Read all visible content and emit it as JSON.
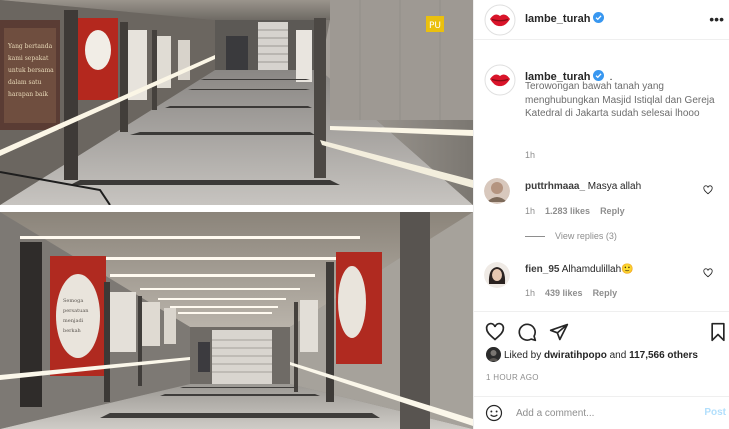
{
  "post": {
    "author": "lambe_turah",
    "verified": true,
    "caption_author": "lambe_turah",
    "caption_dot": ".",
    "caption": "Terowongan bawah tanah yang menghubungkan Masjid Istiqlal dan Gereja Katedral di Jakarta sudah selesai lhooo",
    "caption_time": "1h",
    "image_alt": "Terowongan bawah tanah (tunnel interior photos)"
  },
  "comments": [
    {
      "username": "puttrhmaaa_",
      "text": "Masya allah",
      "time": "1h",
      "likes": "1.283 likes",
      "reply": "Reply",
      "view_replies": "View replies (3)"
    },
    {
      "username": "fien_95",
      "text": "Alhamdulillah🙂",
      "time": "1h",
      "likes": "439 likes",
      "reply": "Reply"
    }
  ],
  "engagement": {
    "liked_prefix": "Liked by ",
    "liked_user": "dwiratihpopo",
    "liked_and": " and ",
    "liked_others": "117,566 others",
    "time_ago": "1 HOUR AGO"
  },
  "composer": {
    "placeholder": "Add a comment...",
    "post_label": "Post"
  },
  "colors": {
    "verified_blue": "#3897f0",
    "post_disabled": "#b2dffc",
    "avatar_red": "#d9142a"
  },
  "icons": {
    "more": "more-horizontal-icon",
    "like": "heart-icon",
    "comment": "comment-icon",
    "share": "paper-plane-icon",
    "save": "bookmark-icon",
    "emoji": "emoji-icon"
  }
}
